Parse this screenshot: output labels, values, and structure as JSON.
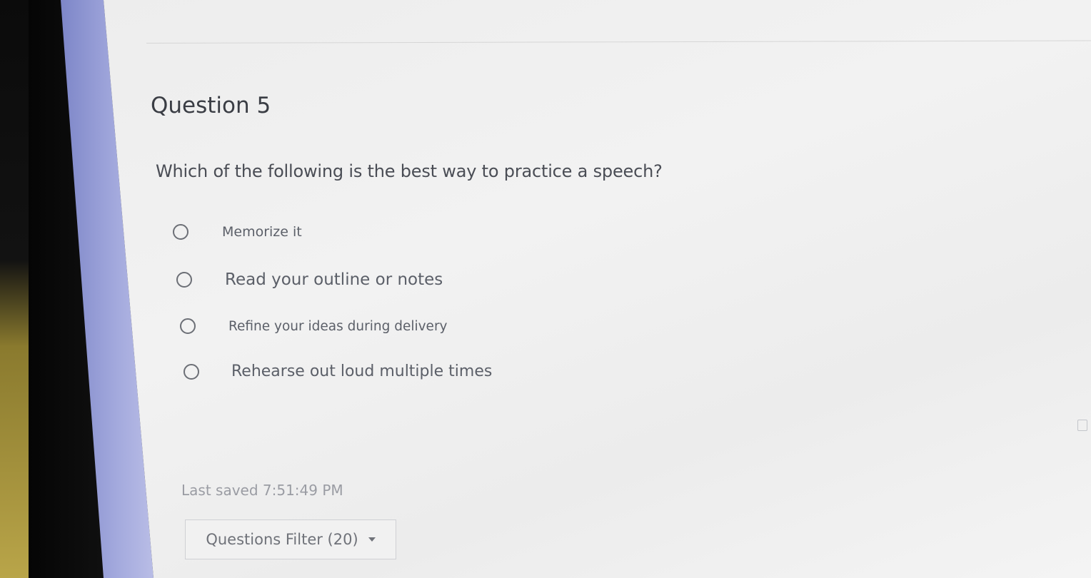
{
  "question": {
    "title": "Question 5",
    "prompt": "Which of the following is the best way to practice a speech?",
    "options": [
      {
        "label": "Memorize it",
        "selected": false
      },
      {
        "label": "Read your outline or notes",
        "selected": false
      },
      {
        "label": "Refine your ideas during delivery",
        "selected": false
      },
      {
        "label": "Rehearse out loud multiple times",
        "selected": false
      }
    ]
  },
  "status": {
    "last_saved": "Last saved 7:51:49 PM"
  },
  "filter": {
    "label": "Questions Filter (20)"
  },
  "icons": {
    "dropdown": "caret-down-icon",
    "edge": "panel-icon"
  },
  "colors": {
    "page_background": "#efefef",
    "text_primary": "#3a3d44",
    "text_muted": "#9a9ca3",
    "left_rail": "#a3a9dd"
  }
}
